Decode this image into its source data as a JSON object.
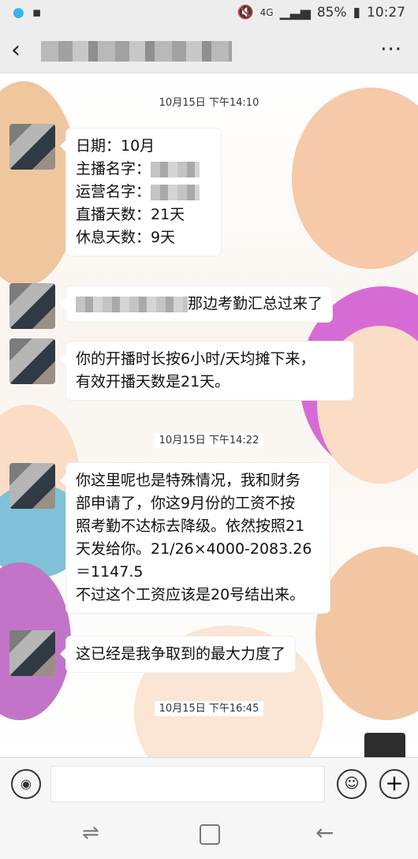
{
  "statusbar": {
    "network": "4G",
    "battery": "85%",
    "time": "10:27"
  },
  "header": {
    "back_icon": "‹",
    "more_icon": "···"
  },
  "messages": [
    {
      "type": "timestamp",
      "text": "10月15日 下午14:10"
    },
    {
      "type": "bubble",
      "lines": [
        "日期：10月",
        "主播名字：",
        "运营名字：",
        "直播天数：21天",
        "休息天数：9天"
      ]
    },
    {
      "type": "bubble",
      "text": "那边考勤汇总过来了"
    },
    {
      "type": "bubble",
      "lines": [
        "你的开播时长按6小时/天均摊下来，",
        "有效开播天数是21天。"
      ]
    },
    {
      "type": "timestamp",
      "text": "10月15日 下午14:22"
    },
    {
      "type": "bubble",
      "lines": [
        "你这里呢也是特殊情况，我和财务",
        "部申请了，你这9月份的工资不按",
        "照考勤不达标去降级。依然按照21",
        "天发给你。21/26×4000-2083.26",
        "＝1147.5",
        "不过这个工资应该是20号结出来。"
      ]
    },
    {
      "type": "bubble",
      "text": "这已经是我争取到的最大力度了"
    },
    {
      "type": "timestamp",
      "text": "10月15日 下午16:45"
    }
  ],
  "inputbar": {
    "voice_icon": "◉",
    "emoji_icon": "☺",
    "plus_icon": "+"
  },
  "sysnav": {
    "recent_icon": "⇌",
    "back_icon": "←"
  }
}
